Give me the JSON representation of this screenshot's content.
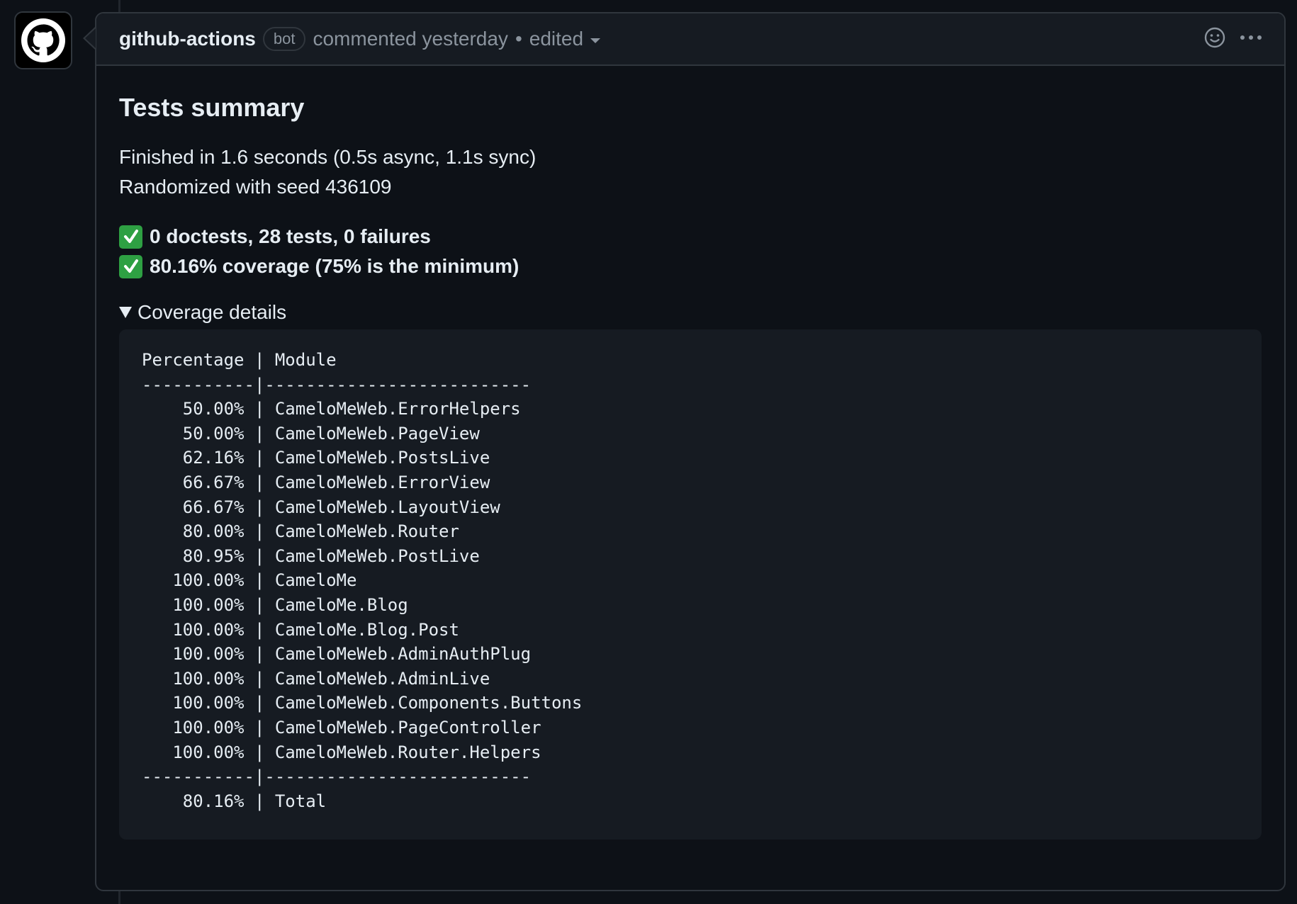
{
  "comment": {
    "author": "github-actions",
    "badge": "bot",
    "meta": "commented yesterday",
    "separator": "•",
    "edited": "edited",
    "actions": [
      "smiley-icon",
      "kebab-menu-icon"
    ]
  },
  "body": {
    "title": "Tests summary",
    "line1": "Finished in 1.6 seconds (0.5s async, 1.1s sync)",
    "line2": "Randomized with seed 436109",
    "check1": "0 doctests, 28 tests, 0 failures",
    "check2": "80.16% coverage (75% is the minimum)",
    "details_summary": "Coverage details",
    "code_lines": [
      "Percentage | Module",
      "-----------|--------------------------",
      "    50.00% | CameloMeWeb.ErrorHelpers",
      "    50.00% | CameloMeWeb.PageView",
      "    62.16% | CameloMeWeb.PostsLive",
      "    66.67% | CameloMeWeb.ErrorView",
      "    66.67% | CameloMeWeb.LayoutView",
      "    80.00% | CameloMeWeb.Router",
      "    80.95% | CameloMeWeb.PostLive",
      "   100.00% | CameloMe",
      "   100.00% | CameloMe.Blog",
      "   100.00% | CameloMe.Blog.Post",
      "   100.00% | CameloMeWeb.AdminAuthPlug",
      "   100.00% | CameloMeWeb.AdminLive",
      "   100.00% | CameloMeWeb.Components.Buttons",
      "   100.00% | CameloMeWeb.PageController",
      "   100.00% | CameloMeWeb.Router.Helpers",
      "-----------|--------------------------",
      "    80.16% | Total"
    ]
  },
  "colors": {
    "background": "#0d1117",
    "header_bg": "#161b22",
    "border": "#30363d",
    "muted": "#8b949e",
    "text": "#e6edf3",
    "check_green": "#2ea043"
  }
}
